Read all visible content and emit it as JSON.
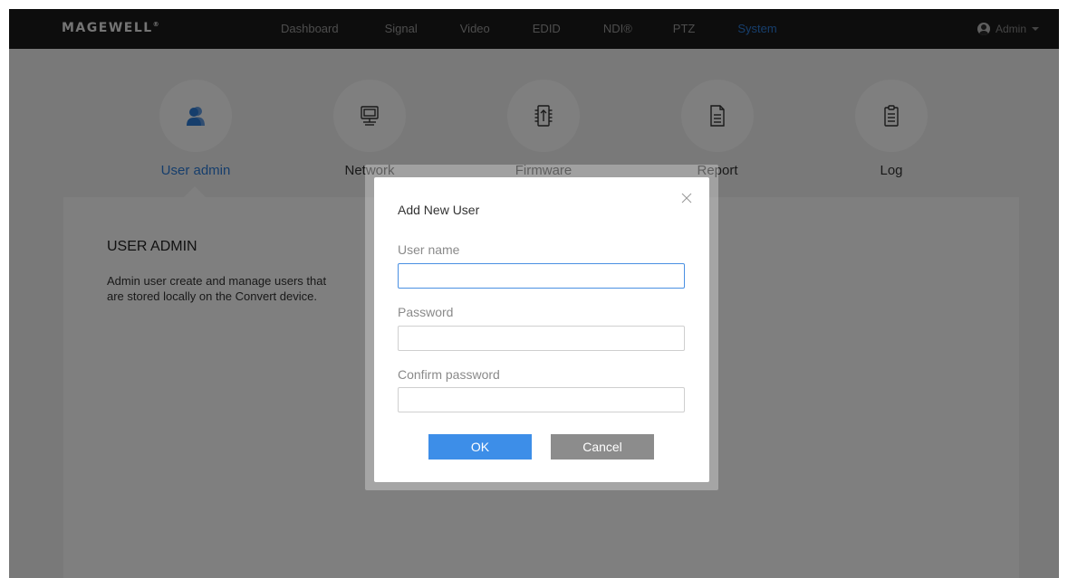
{
  "header": {
    "logo": "MAGEWELL",
    "logo_mark": "®",
    "nav": [
      {
        "label": "Dashboard"
      },
      {
        "label": "Signal"
      },
      {
        "label": "Video"
      },
      {
        "label": "EDID"
      },
      {
        "label": "NDI®"
      },
      {
        "label": "PTZ"
      },
      {
        "label": "System"
      }
    ],
    "active_nav": "System",
    "user": "Admin"
  },
  "categories": [
    {
      "label": "User admin",
      "icon": "users-icon"
    },
    {
      "label": "Network",
      "icon": "monitor-icon"
    },
    {
      "label": "Firmware",
      "icon": "firmware-chip-icon"
    },
    {
      "label": "Report",
      "icon": "document-icon"
    },
    {
      "label": "Log",
      "icon": "clipboard-icon"
    }
  ],
  "active_category": "User admin",
  "section": {
    "title": "USER ADMIN",
    "description": "Admin user create and manage users that are stored locally on the Convert device."
  },
  "dialog": {
    "title": "Add New User",
    "fields": [
      {
        "label": "User name",
        "value": ""
      },
      {
        "label": "Password",
        "value": ""
      },
      {
        "label": "Confirm password",
        "value": ""
      }
    ],
    "ok_label": "OK",
    "cancel_label": "Cancel"
  },
  "colors": {
    "accent": "#2d7cd8",
    "topbar": "#1a1a1a",
    "ok_button": "#3d8ee8",
    "cancel_button": "#8c8c8c"
  }
}
